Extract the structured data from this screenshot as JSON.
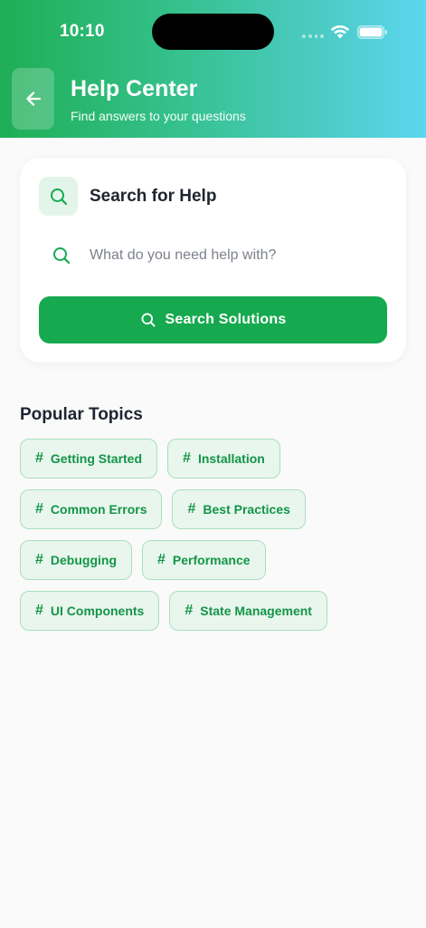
{
  "status_bar": {
    "time": "10:10"
  },
  "header": {
    "title": "Help Center",
    "subtitle": "Find answers to your questions"
  },
  "search_card": {
    "title": "Search for Help",
    "input_value": "",
    "input_placeholder": "What do you need help with?",
    "button_label": "Search Solutions"
  },
  "topics": {
    "title": "Popular Topics",
    "rows": [
      [
        "Getting Started",
        "Installation"
      ],
      [
        "Common Errors",
        "Best Practices"
      ],
      [
        "Debugging",
        "Performance"
      ],
      [
        "UI Components",
        "State Management"
      ]
    ]
  },
  "icons": {
    "back": "arrow-left-icon",
    "search": "search-icon",
    "topic": "hash-icon",
    "wifi": "wifi-icon",
    "battery": "battery-icon"
  },
  "colors": {
    "header_gradient_start": "#1fae55",
    "header_gradient_end": "#5bd6ef",
    "primary": "#16a94f",
    "chip_bg": "#e8f6ee",
    "chip_border": "#a9dfbf",
    "chip_text": "#149446",
    "page_bg": "#fafafa"
  }
}
